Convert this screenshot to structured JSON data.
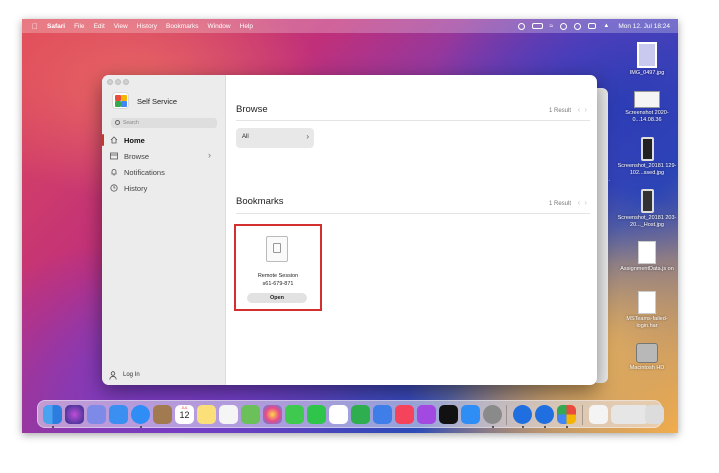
{
  "menubar": {
    "app": "Safari",
    "items": [
      "File",
      "Edit",
      "View",
      "History",
      "Bookmarks",
      "Window",
      "Help"
    ],
    "clock": "Mon 12. Jul  18:24"
  },
  "desktop": {
    "icons": [
      {
        "label": "IMG_0497.jpg"
      },
      {
        "label": "Screenshot 2020-0...14.08.36"
      },
      {
        "label": "Screenshot_20181 129-102...ssed.jpg"
      },
      {
        "label": "Screenshot_20181 203-20..._Host.jpg"
      },
      {
        "label": "AssignmentData.js on"
      },
      {
        "label": "MSTeams-failed-login.har"
      },
      {
        "label": "Macintosh HD"
      }
    ],
    "partial_text": "2..."
  },
  "app": {
    "title": "Self Service",
    "search_placeholder": "Search",
    "nav": [
      {
        "label": "Home",
        "active": true
      },
      {
        "label": "Browse",
        "active": false
      },
      {
        "label": "Notifications",
        "active": false
      },
      {
        "label": "History",
        "active": false
      }
    ],
    "login": "Log In"
  },
  "main": {
    "browse": {
      "title": "Browse",
      "result": "1 Result",
      "button": "All"
    },
    "bookmarks": {
      "title": "Bookmarks",
      "result": "1 Result",
      "item_name": "Remote Session",
      "item_id": "s61-679-871",
      "open_label": "Open"
    }
  },
  "colors": {
    "highlight": "#d32f2f",
    "active_bar": "#c0392b"
  },
  "dock": {
    "icons": [
      "finder-icon",
      "siri-icon",
      "launchpad-icon",
      "mail-icon",
      "safari-icon",
      "contacts-icon",
      "calendar-icon",
      "notes-icon",
      "reminders-icon",
      "maps-icon",
      "photos-icon",
      "messages-icon",
      "facetime-icon",
      "freeform-icon",
      "numbers-icon",
      "keynote-icon",
      "music-icon",
      "podcasts-icon",
      "appletv-icon",
      "appstore-icon",
      "system-preferences-icon",
      "teamviewer-icon",
      "teamviewer2-icon",
      "self-service-icon",
      "preview-icon",
      "screenshots-icon",
      "trash-icon"
    ],
    "calendar_day": "12",
    "calendar_month": "JUL"
  }
}
